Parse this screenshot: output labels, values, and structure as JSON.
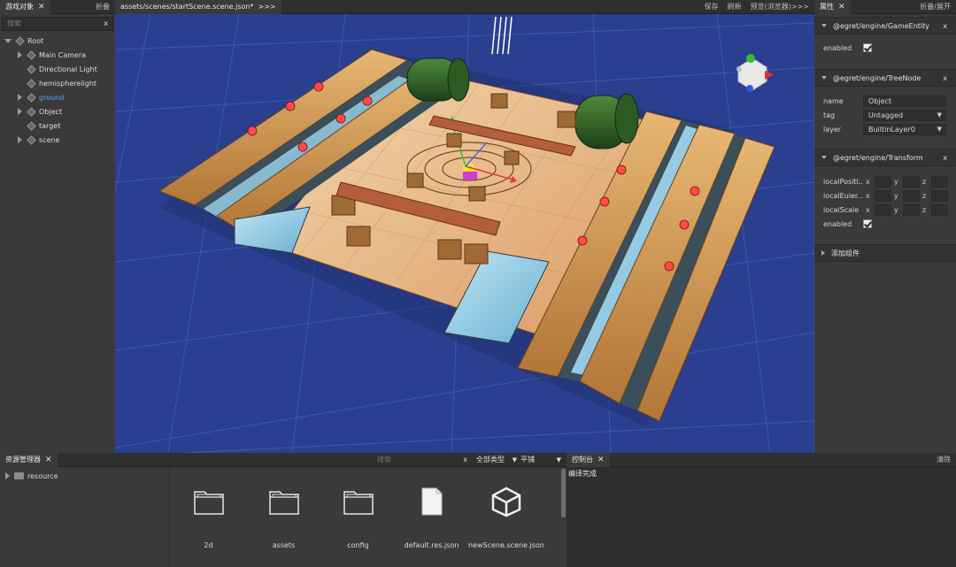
{
  "hierarchy": {
    "tab_label": "游戏对象",
    "collapse_label": "折叠",
    "search_placeholder": "搜索",
    "search_clear": "x",
    "items": [
      {
        "label": "Root",
        "indent": 0,
        "expanded": true
      },
      {
        "label": "Main Camera",
        "indent": 1,
        "expanded": false
      },
      {
        "label": "Directional Light",
        "indent": 1,
        "expanded": null
      },
      {
        "label": "hemispherelight",
        "indent": 1,
        "expanded": null
      },
      {
        "label": "ground",
        "indent": 1,
        "expanded": false,
        "selected": true
      },
      {
        "label": "Object",
        "indent": 1,
        "expanded": false
      },
      {
        "label": "target",
        "indent": 1,
        "expanded": null
      },
      {
        "label": "scene",
        "indent": 1,
        "expanded": false
      }
    ]
  },
  "scene": {
    "tab_label": "assets/scenes/startScene.scene.json*",
    "tab_more": ">>>",
    "save_label": "保存",
    "refresh_label": "刷新",
    "preview_label": "预览(浏览器)>>>"
  },
  "inspector": {
    "tab_label": "属性",
    "collapse_label": "折叠/展开",
    "components": {
      "game_entity": {
        "title": "@egret/engine/GameEntity",
        "enabled_label": "enabled",
        "enabled": true
      },
      "tree_node": {
        "title": "@egret/engine/TreeNode",
        "name_label": "name",
        "name_value": "Object",
        "tag_label": "tag",
        "tag_value": "Untagged",
        "layer_label": "layer",
        "layer_value": "BuiltinLayer0"
      },
      "transform": {
        "title": "@egret/engine/Transform",
        "pos_label": "localPositi...",
        "euler_label": "localEuler...",
        "scale_label": "localScale",
        "enabled_label": "enabled",
        "enabled": true,
        "axes": [
          "x",
          "y",
          "z"
        ]
      }
    },
    "add_component_label": "添加组件",
    "close_label": "x",
    "dropdown_icon": "▼"
  },
  "assets": {
    "tab_label": "资源管理器",
    "search_placeholder": "搜索",
    "search_clear": "x",
    "type_filter": "全部类型",
    "view_mode": "平铺",
    "tree": [
      {
        "label": "resource"
      }
    ],
    "items": [
      {
        "name": "2d",
        "icon": "folder-icon"
      },
      {
        "name": "assets",
        "icon": "folder-icon"
      },
      {
        "name": "config",
        "icon": "folder-icon"
      },
      {
        "name": "default.res.json",
        "icon": "file-icon"
      },
      {
        "name": "newScene.scene.json",
        "icon": "cube-icon"
      }
    ]
  },
  "console": {
    "tab_label": "控制台",
    "clear_label": "清除",
    "lines": [
      "编译完成"
    ]
  },
  "colors": {
    "viewport_bg": "#2a3f8f",
    "grid": "#4a63b8",
    "selected_text": "#5aa2f0",
    "panel": "#3a3a3a"
  }
}
